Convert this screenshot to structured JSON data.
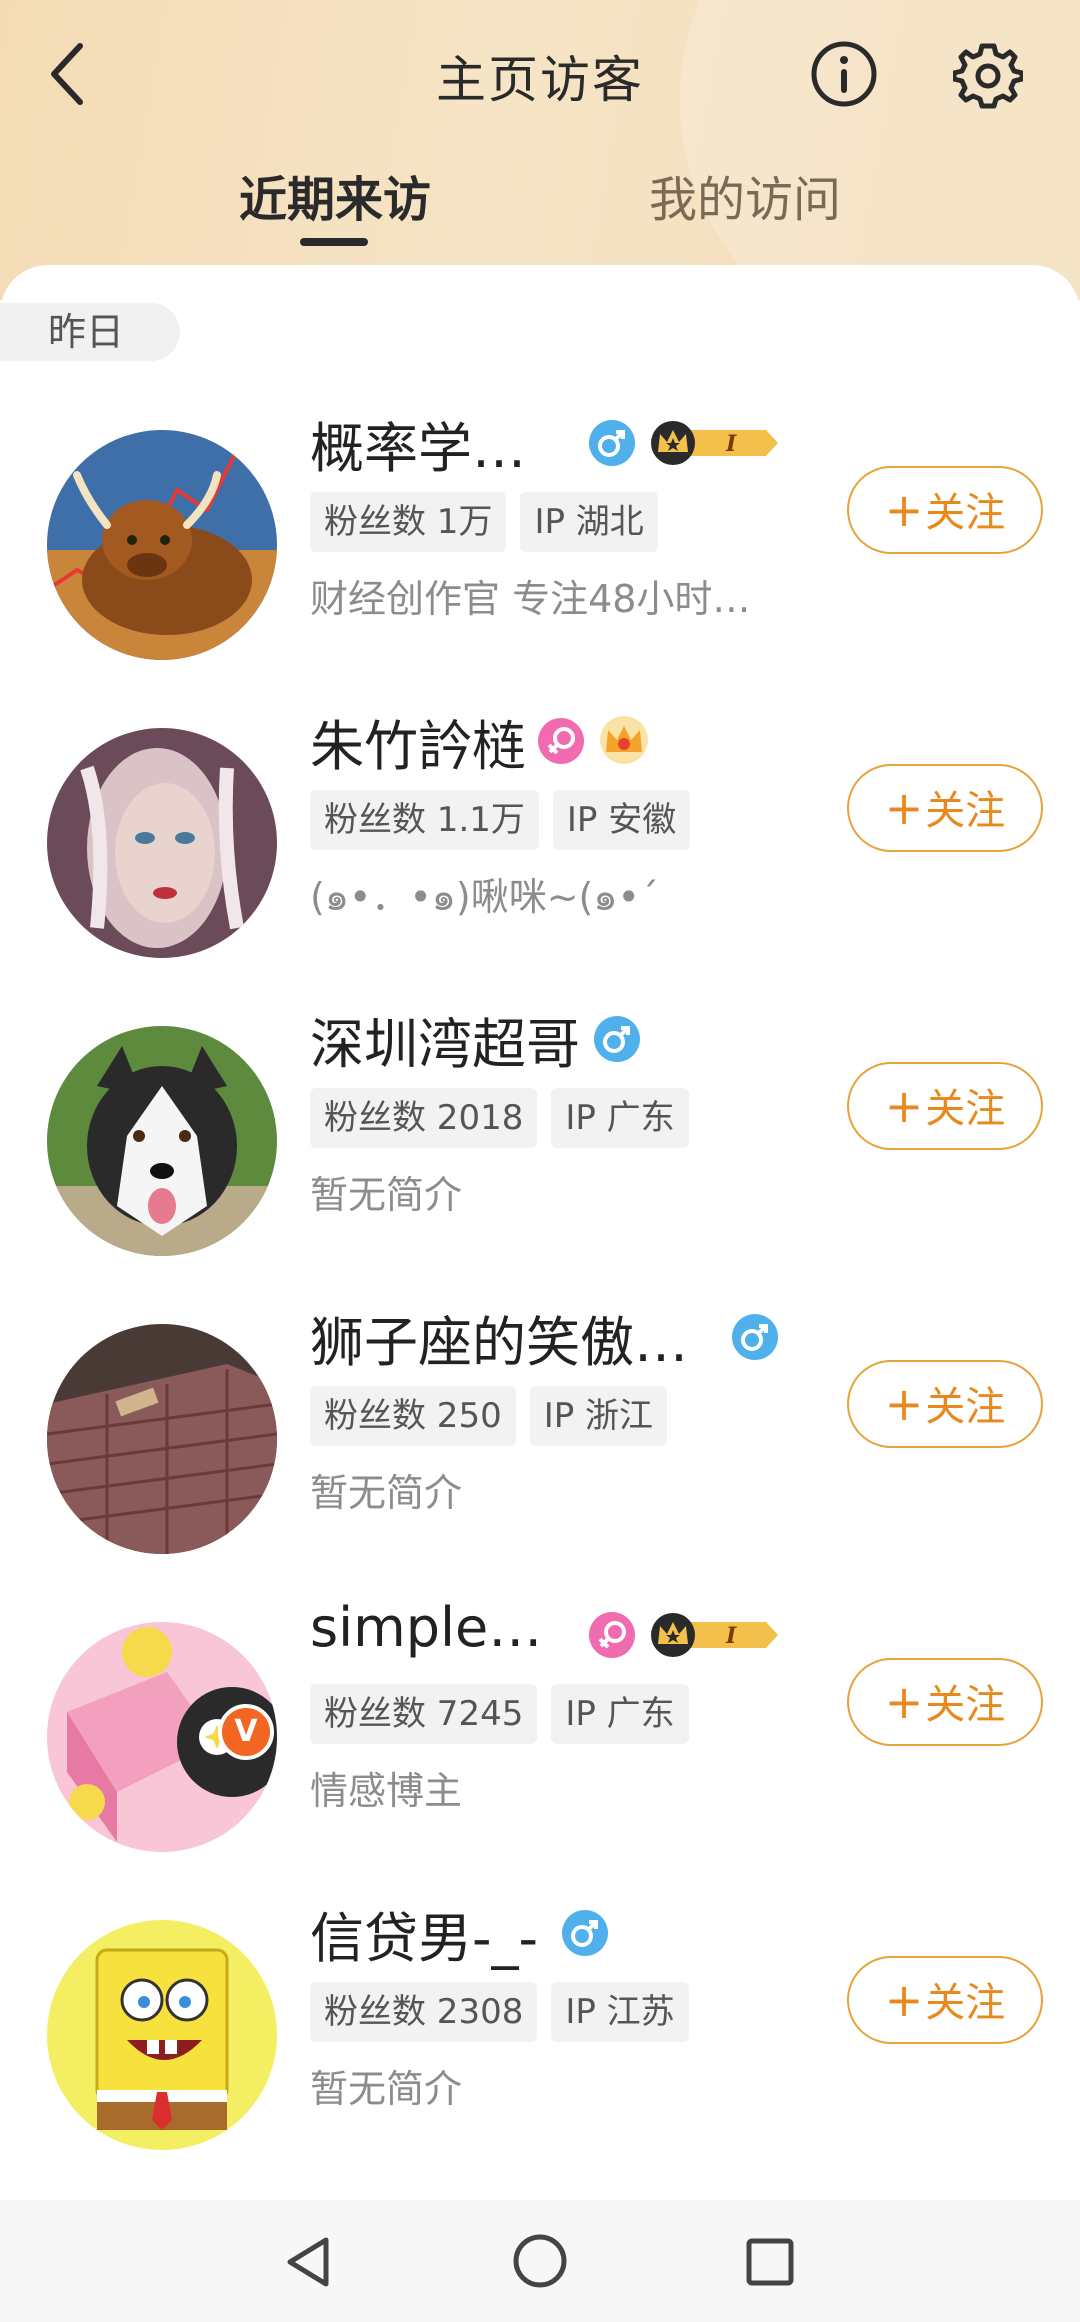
{
  "header": {
    "title": "主页访客",
    "back_icon": "chevron-left-icon",
    "info_icon": "info-circle-icon",
    "settings_icon": "gear-icon",
    "tabs": [
      {
        "label": "近期来访",
        "active": true
      },
      {
        "label": "我的访问",
        "active": false
      }
    ]
  },
  "section": {
    "date_label": "昨日"
  },
  "visitors": [
    {
      "name": "概率学…",
      "gender": "male",
      "crown": true,
      "level": "I",
      "fans": "粉丝数 1万",
      "ip": "IP 湖北",
      "bio": "财经创作官 专注48小时…",
      "follow": "关注",
      "verified": false
    },
    {
      "name": "朱竹訡梿",
      "gender": "female",
      "crown": true,
      "level": "",
      "fans": "粉丝数 1.1万",
      "ip": "IP 安徽",
      "bio": "(๑•．•๑)啾咪~(๑•´",
      "follow": "关注",
      "verified": false
    },
    {
      "name": "深圳湾超哥",
      "gender": "male",
      "crown": false,
      "level": "",
      "fans": "粉丝数 2018",
      "ip": "IP 广东",
      "bio": "暂无简介",
      "follow": "关注",
      "verified": false
    },
    {
      "name": "狮子座的笑傲…",
      "gender": "male",
      "crown": false,
      "level": "",
      "fans": "粉丝数 250",
      "ip": "IP 浙江",
      "bio": "暂无简介",
      "follow": "关注",
      "verified": false
    },
    {
      "name": "simple…",
      "gender": "female",
      "crown": true,
      "level": "I",
      "fans": "粉丝数 7245",
      "ip": "IP 广东",
      "bio": "情感博主",
      "follow": "关注",
      "verified": true
    },
    {
      "name": "信贷男-_-",
      "gender": "male",
      "crown": false,
      "level": "",
      "fans": "粉丝数 2308",
      "ip": "IP 江苏",
      "bio": "暂无简介",
      "follow": "关注",
      "verified": false
    }
  ],
  "colors": {
    "accent": "#e8891d",
    "male": "#4fb0ec",
    "female": "#f06bb0",
    "header": "#f3dcb5"
  },
  "navbar": {
    "back_icon": "nav-back-triangle-icon",
    "home_icon": "nav-home-circle-icon",
    "recent_icon": "nav-recent-square-icon"
  }
}
